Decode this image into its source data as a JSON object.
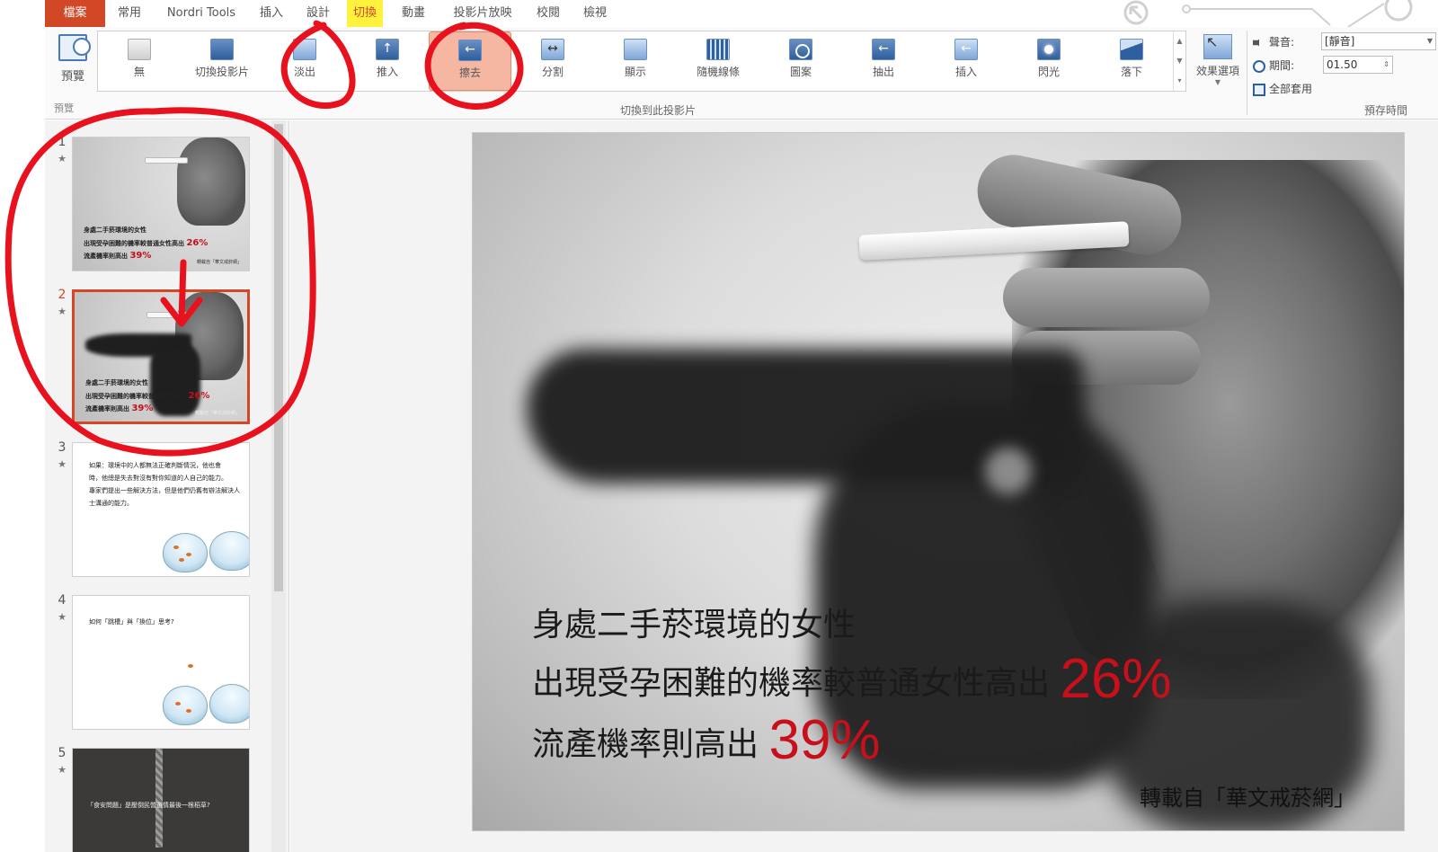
{
  "menu": {
    "tabs": [
      "檔案",
      "常用",
      "Nordri Tools",
      "插入",
      "設計",
      "切換",
      "動畫",
      "投影片放映",
      "校閱",
      "檢視"
    ],
    "active": "切換"
  },
  "ribbon": {
    "preview_label": "預覽",
    "preview_group_label": "預覽",
    "transitions": [
      {
        "label": "無",
        "icon": "none-transition-icon"
      },
      {
        "label": "切換投影片",
        "icon": "cut-transition-icon"
      },
      {
        "label": "淡出",
        "icon": "fade-transition-icon"
      },
      {
        "label": "推入",
        "icon": "push-transition-icon"
      },
      {
        "label": "擦去",
        "icon": "wipe-transition-icon"
      },
      {
        "label": "分割",
        "icon": "split-transition-icon"
      },
      {
        "label": "顯示",
        "icon": "reveal-transition-icon"
      },
      {
        "label": "隨機線條",
        "icon": "random-bars-transition-icon"
      },
      {
        "label": "圖案",
        "icon": "shape-transition-icon"
      },
      {
        "label": "抽出",
        "icon": "uncover-transition-icon"
      },
      {
        "label": "插入",
        "icon": "cover-transition-icon"
      },
      {
        "label": "閃光",
        "icon": "flash-transition-icon"
      },
      {
        "label": "落下",
        "icon": "fall-transition-icon"
      }
    ],
    "selected_transition": "擦去",
    "effect_options_label": "效果選項",
    "transition_group_label": "切換到此投影片",
    "timing": {
      "sound_label": "聲音:",
      "sound_value": "[靜音]",
      "duration_label": "期間:",
      "duration_value": "01.50",
      "apply_all_label": "全部套用",
      "group_label": "預存時間"
    }
  },
  "thumbnails": [
    {
      "num": "1",
      "lines": [
        "身處二手菸環境的女性",
        "出現受孕困難的機率較普通女性高出",
        "流產機率則高出"
      ],
      "pcts": [
        "26%",
        "39%"
      ],
      "source": "轉載自「華文戒菸網」"
    },
    {
      "num": "2",
      "lines": [
        "身處二手菸環境的女性",
        "出現受孕困難的機率較普通女性高出",
        "流產機率則高出"
      ],
      "pcts": [
        "26%",
        "39%"
      ],
      "source": "轉載自「華文戒菸網」"
    },
    {
      "num": "3",
      "lines": [
        "如果：環境中的人都無法正確判斷情況，他也會",
        "時，他總是失去對沒有對你知道的人自己的能力。",
        "專家們提出一些解決方法，但是他們仍舊有辦法解決人",
        "士溝通的能力。"
      ]
    },
    {
      "num": "4",
      "lines": [
        "如何「跳槽」與「換位」思考?"
      ]
    },
    {
      "num": "5",
      "lines": [
        "「食安問題」是壓倒民營選情最後一根稻草?"
      ]
    }
  ],
  "selected_slide": "2",
  "slide": {
    "line1": "身處二手菸環境的女性",
    "line2": "出現受孕困難的機率較普通女性高出",
    "pct1": "26%",
    "line3": "流產機率則高出",
    "pct2": "39%",
    "source": "轉載自「華文戒菸網」"
  },
  "colors": {
    "accent": "#d24726",
    "highlight": "#fff23c",
    "selected_gallery": "#f5b7a2",
    "annotation": "#e8121e",
    "percent_red": "#c8101c"
  }
}
